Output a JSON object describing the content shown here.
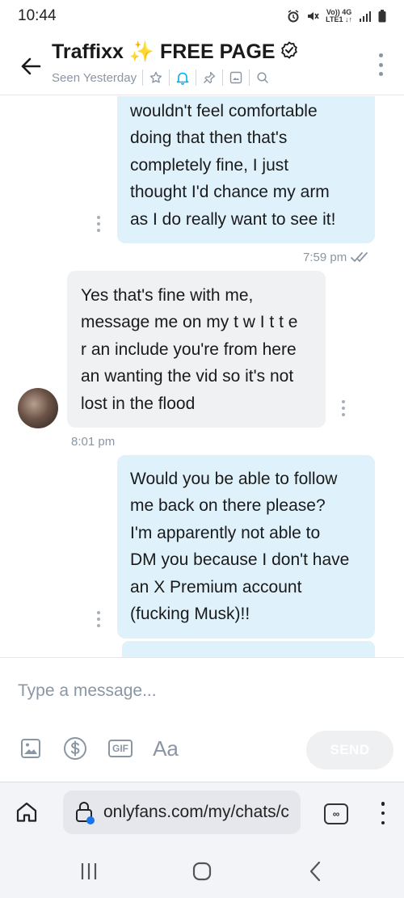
{
  "status_bar": {
    "time": "10:44",
    "network_top": "Vo)) 4G",
    "network_bottom": "LTE1 ↓↑"
  },
  "header": {
    "title": "Traffixx ✨ FREE PAGE",
    "seen_status": "Seen Yesterday",
    "actions": [
      "star-icon",
      "bell-icon",
      "pin-icon",
      "media-icon",
      "search-icon"
    ]
  },
  "chat": {
    "messages": [
      {
        "direction": "outgoing",
        "lines": [
          "wouldn't feel comfortable",
          "doing that then that's",
          "completely fine, I just",
          "thought I'd chance my arm",
          "as I do really want to see it!"
        ],
        "time": "7:59 pm",
        "read": true
      },
      {
        "direction": "incoming",
        "lines": [
          "Yes that's fine with me,",
          "message me on my t w I t t e",
          "r an include you're from here",
          "an wanting the vid so it's not",
          "lost in the flood"
        ],
        "time": "8:01 pm"
      },
      {
        "direction": "outgoing",
        "lines": [
          "Would you be able to follow",
          "me back on there please?",
          "I'm apparently not able to",
          "DM you because I don't have",
          "an X Premium account",
          "(fucking Musk)!!"
        ]
      }
    ]
  },
  "composer": {
    "placeholder": "Type a message...",
    "gif_label": "GIF",
    "text_format_label": "Aa",
    "send_label": "SEND"
  },
  "browser": {
    "url": "onlyfans.com/my/chats/c",
    "tabs_count": "∞"
  },
  "colors": {
    "accent": "#00aff0",
    "outgoing_bubble": "#dff2fc",
    "incoming_bubble": "#f0f1f3",
    "muted_text": "#8a96a3"
  }
}
